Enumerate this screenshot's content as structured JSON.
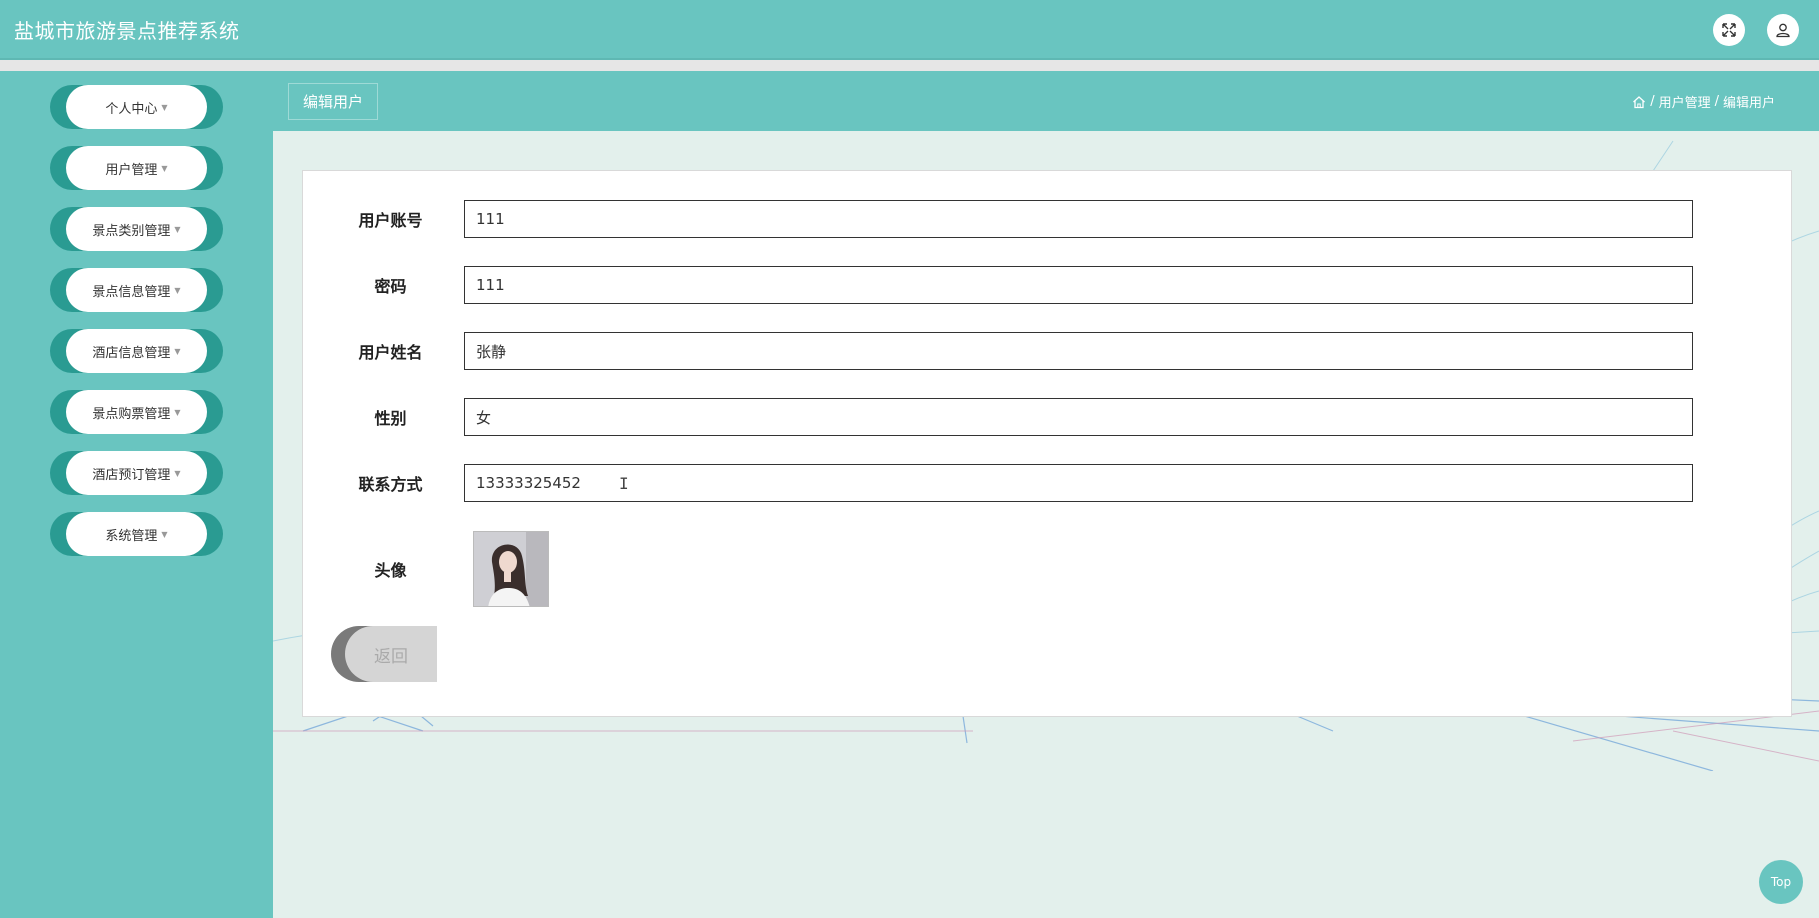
{
  "header": {
    "title": "盐城市旅游景点推荐系统",
    "fullscreen_icon": "expand-icon",
    "user_icon": "user-icon"
  },
  "sidebar": {
    "items": [
      {
        "label": "个人中心"
      },
      {
        "label": "用户管理"
      },
      {
        "label": "景点类别管理"
      },
      {
        "label": "景点信息管理"
      },
      {
        "label": "酒店信息管理"
      },
      {
        "label": "景点购票管理"
      },
      {
        "label": "酒店预订管理"
      },
      {
        "label": "系统管理"
      }
    ]
  },
  "subbar": {
    "tab_label": "编辑用户",
    "breadcrumb": {
      "home_icon": "home-icon",
      "sep": "/",
      "level1": "用户管理",
      "level2": "编辑用户"
    }
  },
  "form": {
    "account_label": "用户账号",
    "account_value": "111",
    "password_label": "密码",
    "password_value": "111",
    "name_label": "用户姓名",
    "name_value": "张静",
    "gender_label": "性别",
    "gender_value": "女",
    "contact_label": "联系方式",
    "contact_value": "13333325452",
    "avatar_label": "头像",
    "back_label": "返回"
  },
  "top_button": "Top",
  "colors": {
    "primary": "#69c5c0",
    "primary_dark": "#2a9b92",
    "background": "#e3f0ec"
  }
}
